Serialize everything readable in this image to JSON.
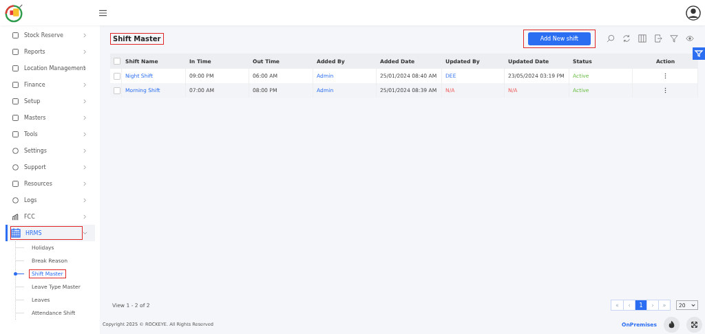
{
  "sidebar": {
    "items": [
      {
        "label": "Stock Reserve",
        "expanded": false,
        "selected": false,
        "highlighted": false
      },
      {
        "label": "Reports",
        "expanded": false,
        "selected": false,
        "highlighted": false
      },
      {
        "label": "Location Management",
        "expanded": false,
        "selected": false,
        "highlighted": false
      },
      {
        "label": "Finance",
        "expanded": false,
        "selected": false,
        "highlighted": false
      },
      {
        "label": "Setup",
        "expanded": false,
        "selected": false,
        "highlighted": false
      },
      {
        "label": "Masters",
        "expanded": false,
        "selected": false,
        "highlighted": false
      },
      {
        "label": "Tools",
        "expanded": false,
        "selected": false,
        "highlighted": false
      },
      {
        "label": "Settings",
        "expanded": false,
        "selected": false,
        "highlighted": false
      },
      {
        "label": "Support",
        "expanded": false,
        "selected": false,
        "highlighted": false
      },
      {
        "label": "Resources",
        "expanded": false,
        "selected": false,
        "highlighted": false
      },
      {
        "label": "Logs",
        "expanded": false,
        "selected": false,
        "highlighted": false
      },
      {
        "label": "FCC",
        "expanded": false,
        "selected": false,
        "highlighted": false
      },
      {
        "label": "HRMS",
        "expanded": true,
        "selected": true,
        "highlighted": true,
        "children": [
          {
            "label": "Holidays",
            "selected": false,
            "highlighted": false
          },
          {
            "label": "Break Reason",
            "selected": false,
            "highlighted": false
          },
          {
            "label": "Shift Master",
            "selected": true,
            "highlighted": true
          },
          {
            "label": "Leave Type Master",
            "selected": false,
            "highlighted": false
          },
          {
            "label": "Leaves",
            "selected": false,
            "highlighted": false
          },
          {
            "label": "Attendance Shift",
            "selected": false,
            "highlighted": false
          }
        ]
      }
    ]
  },
  "page": {
    "title": "Shift Master",
    "title_highlighted": true,
    "add_button": "Add New shift",
    "add_button_highlighted": true
  },
  "table": {
    "all_checked": false,
    "columns": [
      "Shift Name",
      "In Time",
      "Out Time",
      "Added By",
      "Added Date",
      "Updated By",
      "Updated Date",
      "Status",
      "Action"
    ],
    "rows": [
      {
        "checked": false,
        "cells": [
          {
            "text": "Night Shift",
            "kind": "link"
          },
          {
            "text": "09:00 PM",
            "kind": "plain"
          },
          {
            "text": "06:00 AM",
            "kind": "plain"
          },
          {
            "text": "Admin",
            "kind": "link"
          },
          {
            "text": "25/01/2024 08:40 AM",
            "kind": "plain"
          },
          {
            "text": "DEE",
            "kind": "link"
          },
          {
            "text": "23/05/2024 03:19 PM",
            "kind": "plain"
          },
          {
            "text": "Active",
            "kind": "status"
          }
        ]
      },
      {
        "checked": false,
        "cells": [
          {
            "text": "Morning Shift",
            "kind": "link"
          },
          {
            "text": "07:00 AM",
            "kind": "plain"
          },
          {
            "text": "08:00 PM",
            "kind": "plain"
          },
          {
            "text": "Admin",
            "kind": "link"
          },
          {
            "text": "25/01/2024 08:39 AM",
            "kind": "plain"
          },
          {
            "text": "N/A",
            "kind": "missing"
          },
          {
            "text": "N/A",
            "kind": "missing"
          },
          {
            "text": "Active",
            "kind": "status"
          }
        ]
      }
    ]
  },
  "pager": {
    "summary": "View 1 - 2 of 2",
    "buttons": [
      {
        "label": "«",
        "selected": false
      },
      {
        "label": "‹",
        "selected": false
      },
      {
        "label": "1",
        "selected": true
      },
      {
        "label": "›",
        "selected": false
      },
      {
        "label": "»",
        "selected": false
      }
    ],
    "page_size": "20"
  },
  "footer": {
    "copyright": "Copyright 2025 © ROCKEYE. All Rights Reserved",
    "mode": "OnPremises"
  }
}
